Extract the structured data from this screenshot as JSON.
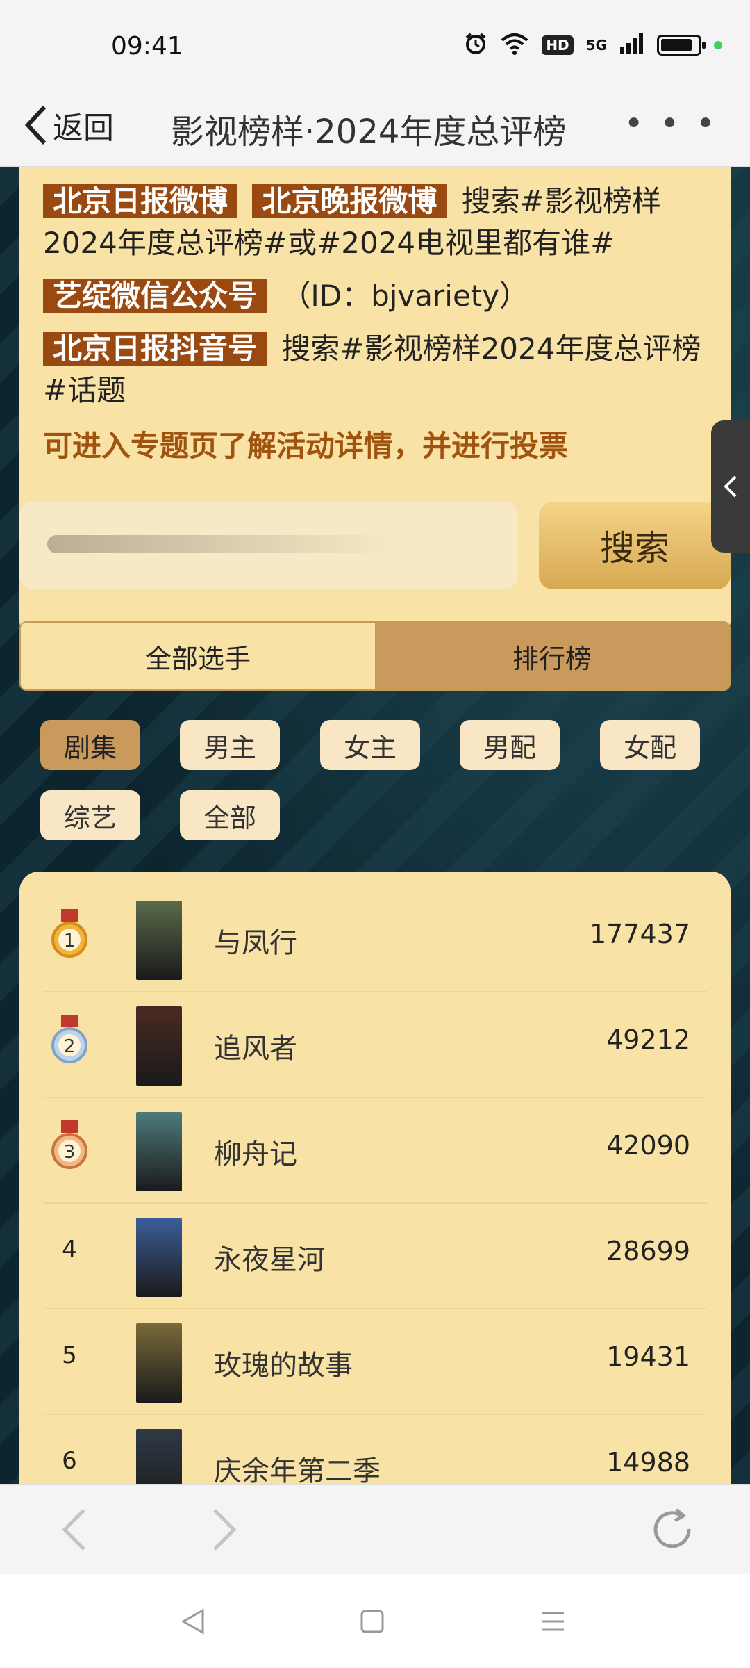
{
  "status": {
    "time": "09:41",
    "hd": "HD",
    "network": "5G",
    "battery_level": 0.85
  },
  "nav": {
    "back_label": "返回",
    "title": "影视榜样·2024年度总评榜",
    "more_label": "• • •"
  },
  "info": {
    "line1_tag1": "北京日报微博",
    "line1_tag2": "北京晚报微博",
    "line1_text": "搜索#影视榜样2024年度总评榜#或#2024电视里都有谁#",
    "line2_tag": "艺绽微信公众号",
    "line2_text": "（ID：bjvariety）",
    "line3_tag": "北京日报抖音号",
    "line3_text": "搜索#影视榜样2024年度总评榜#话题",
    "cta": "可进入专题页了解活动详情，并进行投票"
  },
  "search": {
    "placeholder": "",
    "button_label": "搜索"
  },
  "tabs": [
    {
      "label": "全部选手",
      "active": false
    },
    {
      "label": "排行榜",
      "active": true
    }
  ],
  "chips": [
    {
      "label": "剧集",
      "active": true
    },
    {
      "label": "男主",
      "active": false
    },
    {
      "label": "女主",
      "active": false
    },
    {
      "label": "男配",
      "active": false
    },
    {
      "label": "女配",
      "active": false
    },
    {
      "label": "综艺",
      "active": false
    },
    {
      "label": "全部",
      "active": false
    }
  ],
  "rankings": [
    {
      "rank": "1",
      "medal": "gold",
      "title": "与凤行",
      "score": "177437",
      "poster_color": "#5a6b4a"
    },
    {
      "rank": "2",
      "medal": "silver",
      "title": "追风者",
      "score": "49212",
      "poster_color": "#4a2a22"
    },
    {
      "rank": "3",
      "medal": "bronze",
      "title": "柳舟记",
      "score": "42090",
      "poster_color": "#4f7b7b"
    },
    {
      "rank": "4",
      "medal": "",
      "title": "永夜星河",
      "score": "28699",
      "poster_color": "#3b5f9a"
    },
    {
      "rank": "5",
      "medal": "",
      "title": "玫瑰的故事",
      "score": "19431",
      "poster_color": "#7a6a3a"
    },
    {
      "rank": "6",
      "medal": "",
      "title": "庆余年第二季",
      "score": "14988",
      "poster_color": "#2f3a46"
    }
  ],
  "colors": {
    "card": "#f9e2a5",
    "tag": "#9a4a10",
    "cta": "#a0520f",
    "accent": "#c99a5c"
  },
  "icons": {
    "alarm": "alarm-icon",
    "wifi": "wifi-icon",
    "signal": "signal-icon",
    "battery": "battery-icon",
    "back": "chevron-left-icon",
    "more": "more-dots-icon",
    "side": "chevron-left-icon",
    "browser_back": "arrow-left-icon",
    "browser_forward": "arrow-right-icon",
    "refresh": "refresh-icon",
    "sys_back": "triangle-back-icon",
    "sys_home": "square-home-icon",
    "sys_menu": "menu-lines-icon"
  }
}
